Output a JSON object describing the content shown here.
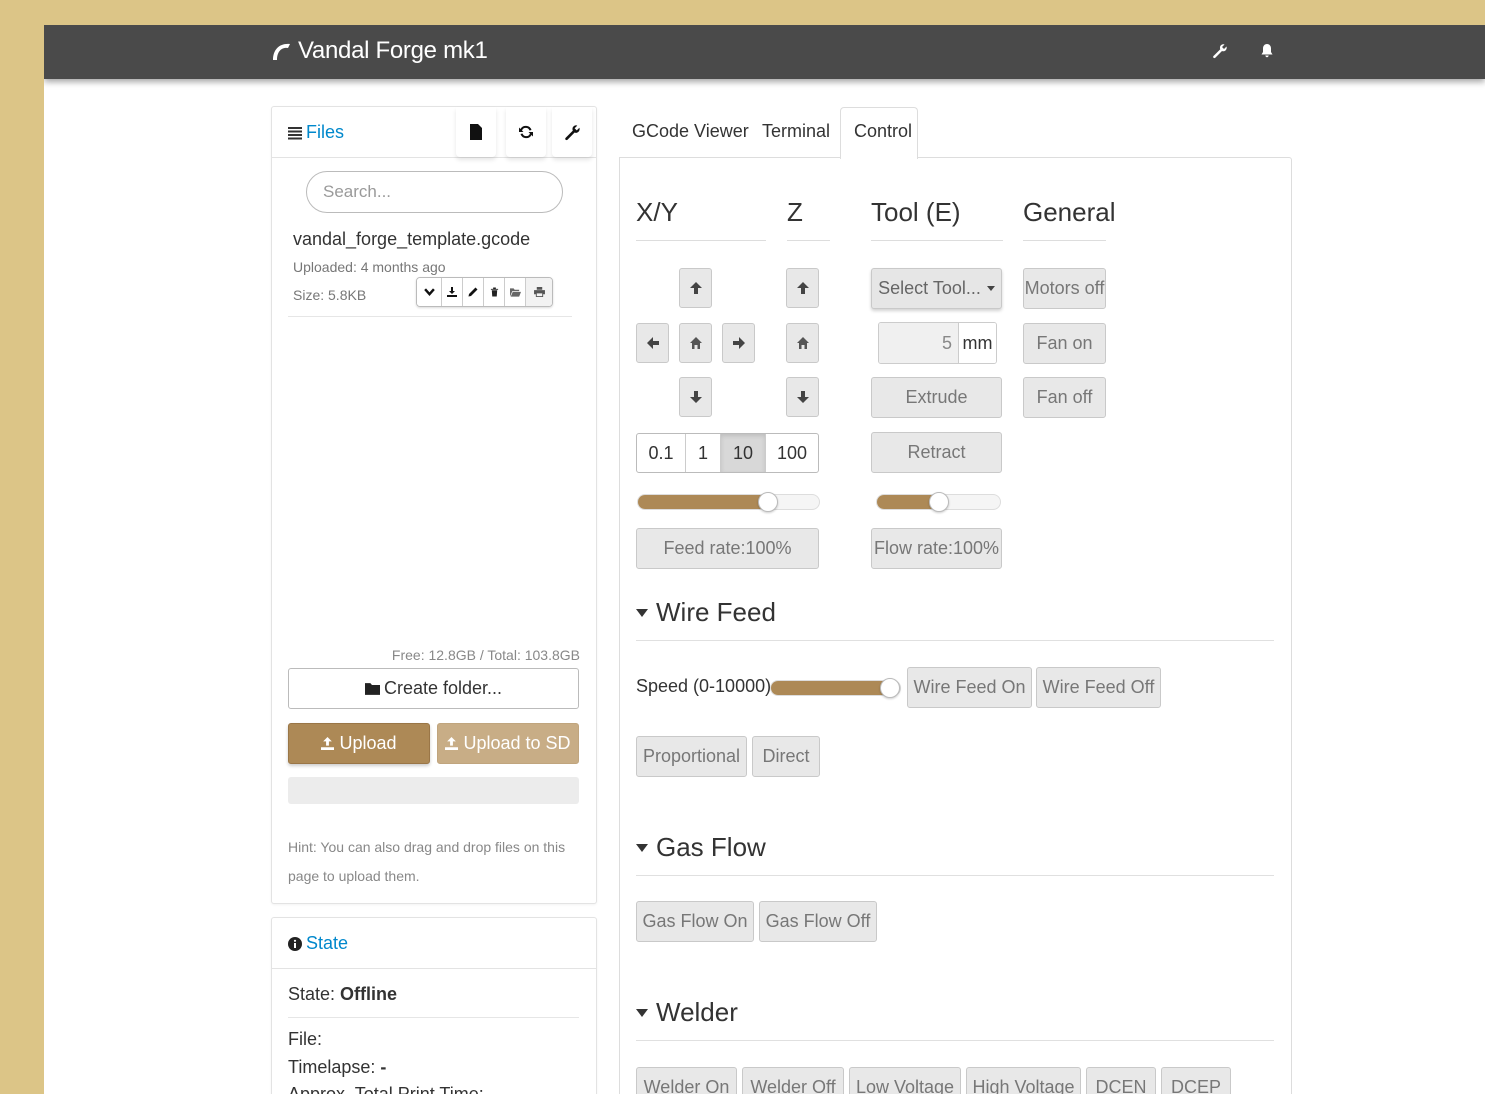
{
  "app": {
    "title": "Vandal Forge mk1"
  },
  "colors": {
    "accent": "#ad8956",
    "navbar": "#4a4a4a",
    "link": "#0088cc",
    "background": "#dcc587"
  },
  "navbar": {
    "icons": [
      "wrench-icon",
      "bell-icon"
    ]
  },
  "files": {
    "title": "Files",
    "search_placeholder": "Search...",
    "items": [
      {
        "name": "vandal_forge_template.gcode",
        "uploaded": "Uploaded: 4 months ago",
        "size": "Size: 5.8KB"
      }
    ],
    "free_space": "Free: 12.8GB / Total: 103.8GB",
    "create_folder": "Create folder...",
    "upload": "Upload",
    "upload_sd": "Upload to SD",
    "hint": "Hint: You can also drag and drop files on this page to upload them."
  },
  "state": {
    "title": "State",
    "state_label": "State: ",
    "state_value": "Offline",
    "file_label": "File:",
    "timelapse_label": "Timelapse: ",
    "timelapse_value": "-",
    "approx_label": "Approx. Total Print Time:"
  },
  "tabs": [
    "GCode Viewer",
    "Terminal",
    "Control"
  ],
  "active_tab": "Control",
  "control": {
    "xy_title": "X/Y",
    "z_title": "Z",
    "tool_title": "Tool (E)",
    "general_title": "General",
    "step_sizes": [
      "0.1",
      "1",
      "10",
      "100"
    ],
    "active_step": "10",
    "feed_rate": "Feed rate:100%",
    "feed_rate_value": 0.72,
    "select_tool": "Select Tool...",
    "extrude_amount": "5",
    "extrude_unit": "mm",
    "extrude": "Extrude",
    "retract": "Retract",
    "flow_rate": "Flow rate:100%",
    "flow_rate_value": 0.5,
    "motors_off": "Motors off",
    "fan_on": "Fan on",
    "fan_off": "Fan off"
  },
  "wire_feed": {
    "title": "Wire Feed",
    "speed_label": "Speed (0-10000)",
    "speed_value": 1.0,
    "on": "Wire Feed On",
    "off": "Wire Feed Off",
    "proportional": "Proportional",
    "direct": "Direct"
  },
  "gas_flow": {
    "title": "Gas Flow",
    "on": "Gas Flow On",
    "off": "Gas Flow Off"
  },
  "welder": {
    "title": "Welder",
    "buttons": [
      "Welder On",
      "Welder Off",
      "Low Voltage",
      "High Voltage",
      "DCEN",
      "DCEP"
    ]
  }
}
